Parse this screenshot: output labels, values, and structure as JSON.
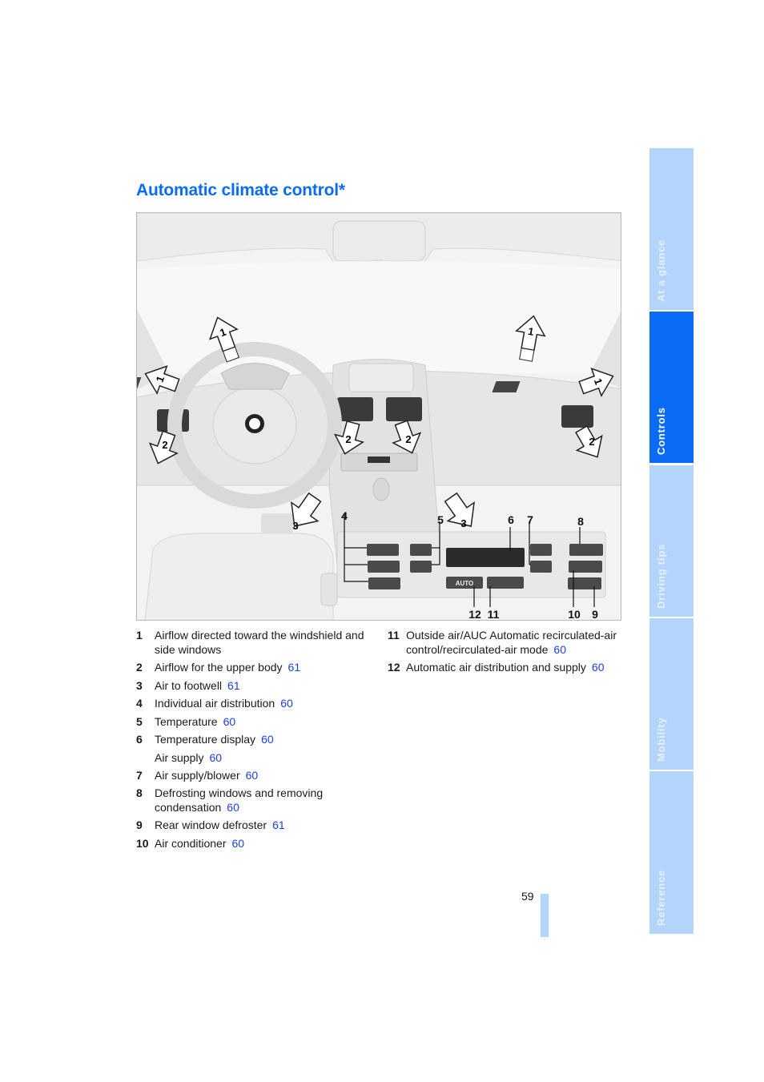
{
  "title": "Automatic climate control*",
  "figure": {
    "callouts": {
      "c1": "1",
      "c2": "2",
      "c3": "3",
      "c4": "4",
      "c5": "5",
      "c6": "6",
      "c7": "7",
      "c8": "8",
      "c9": "9",
      "c10": "10",
      "c11": "11",
      "c12": "12"
    },
    "auto_button": "AUTO"
  },
  "legend_left": [
    {
      "num": "1",
      "text": "Airflow directed toward the windshield and side windows",
      "page": ""
    },
    {
      "num": "2",
      "text": "Airflow for the upper body",
      "page": "61"
    },
    {
      "num": "3",
      "text": "Air to footwell",
      "page": "61"
    },
    {
      "num": "4",
      "text": "Individual air distribution",
      "page": "60"
    },
    {
      "num": "5",
      "text": "Temperature",
      "page": "60"
    },
    {
      "num": "6",
      "text": "Temperature display",
      "page": "60"
    },
    {
      "num": "",
      "text": "Air supply",
      "page": "60"
    },
    {
      "num": "7",
      "text": "Air supply/blower",
      "page": "60"
    },
    {
      "num": "8",
      "text": "Defrosting windows and removing condensation",
      "page": "60"
    },
    {
      "num": "9",
      "text": "Rear window defroster",
      "page": "61"
    },
    {
      "num": "10",
      "text": "Air conditioner",
      "page": "60"
    }
  ],
  "legend_right": [
    {
      "num": "11",
      "text": "Outside air/AUC Automatic recirculated-air control/recirculated-air mode",
      "page": "60"
    },
    {
      "num": "12",
      "text": "Automatic air distribution and supply",
      "page": "60"
    }
  ],
  "page_number": "59",
  "sidebar": {
    "tabs": [
      {
        "label": "At a glance",
        "active": false
      },
      {
        "label": "Controls",
        "active": true
      },
      {
        "label": "Driving tips",
        "active": false
      },
      {
        "label": "Mobility",
        "active": false
      },
      {
        "label": "Reference",
        "active": false
      }
    ]
  },
  "colors": {
    "accent": "#0a6cf0",
    "tab_active": "#0a6cf5",
    "tab_inactive": "#b3d4fb",
    "page_link": "#1a3fe0"
  }
}
